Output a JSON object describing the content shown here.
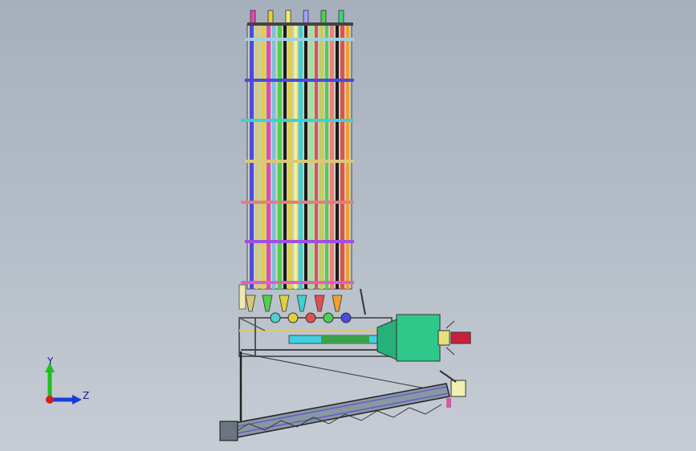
{
  "viewport": {
    "background_top": "#a6b0bd",
    "background_bottom": "#c6ccd4"
  },
  "triad": {
    "y_label": "Y",
    "z_label": "Z",
    "y_color": "#1fbf1f",
    "z_color": "#1b3bd8",
    "x_color": "#d81b1b"
  },
  "model": {
    "tube_colors": [
      "#4a4ae0",
      "#e04ab0",
      "#e0d040",
      "#7ac0e0",
      "#50d050",
      "#e05050",
      "#c0d060",
      "#40d0d0",
      "#f0a030",
      "#d070f0",
      "#f08080",
      "#a0a0ff"
    ],
    "frame_color": "#d9c87a",
    "hopper_color": "#2ec98a",
    "conveyor_color": "#7c8a94"
  }
}
